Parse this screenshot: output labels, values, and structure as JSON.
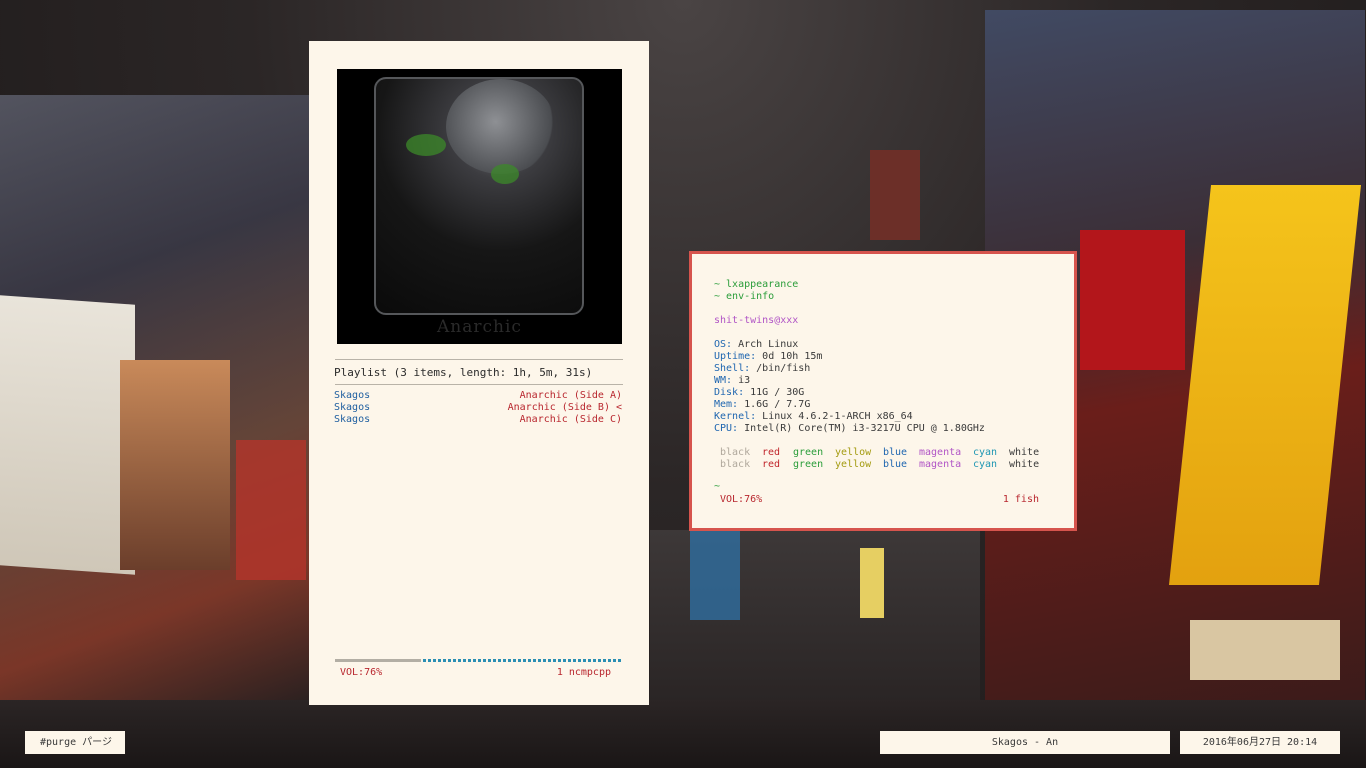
{
  "ncmpcpp": {
    "cover_text": "Anarchic",
    "playlist_header": "Playlist (3 items, length: 1h, 5m, 31s)",
    "playlist": [
      {
        "artist": "Skagos",
        "album": "Anarchic (Side A)"
      },
      {
        "artist": "Skagos",
        "album": "Anarchic (Side B) <"
      },
      {
        "artist": "Skagos",
        "album": "Anarchic (Side C)"
      }
    ],
    "progress": 0.3,
    "volume": "VOL:76%",
    "workspace": "1 ncmpcpp"
  },
  "terminal": {
    "cmd1": "~ lxappearance",
    "cmd2": "~ env-info",
    "user": "shit-twins@xxx",
    "info": [
      {
        "key": "OS:",
        "value": " Arch Linux"
      },
      {
        "key": "Uptime:",
        "value": " 0d 10h 15m"
      },
      {
        "key": "Shell:",
        "value": " /bin/fish"
      },
      {
        "key": "WM:",
        "value": " i3"
      },
      {
        "key": "Disk:",
        "value": " 11G / 30G"
      },
      {
        "key": "Mem:",
        "value": " 1.6G / 7.7G"
      },
      {
        "key": "Kernel:",
        "value": " Linux 4.6.2-1-ARCH x86_64"
      },
      {
        "key": "CPU:",
        "value": " Intel(R) Core(TM) i3-3217U CPU @ 1.80GHz"
      }
    ],
    "palette": [
      "black",
      "red",
      "green",
      "yellow",
      "blue",
      "magenta",
      "cyan",
      "white"
    ],
    "prompt": "~",
    "volume": "VOL:76%",
    "workspace": "1 fish"
  },
  "bar": {
    "workspace": "#purge パージ",
    "song": "Skagos - An",
    "clock": "2016年06月27日 20:14"
  },
  "colors": {
    "panel_bg": "#fdf6ea",
    "accent_red": "#d6544d",
    "blue": "#1f66b0",
    "red": "#c1262c",
    "green": "#2b9d3a"
  }
}
